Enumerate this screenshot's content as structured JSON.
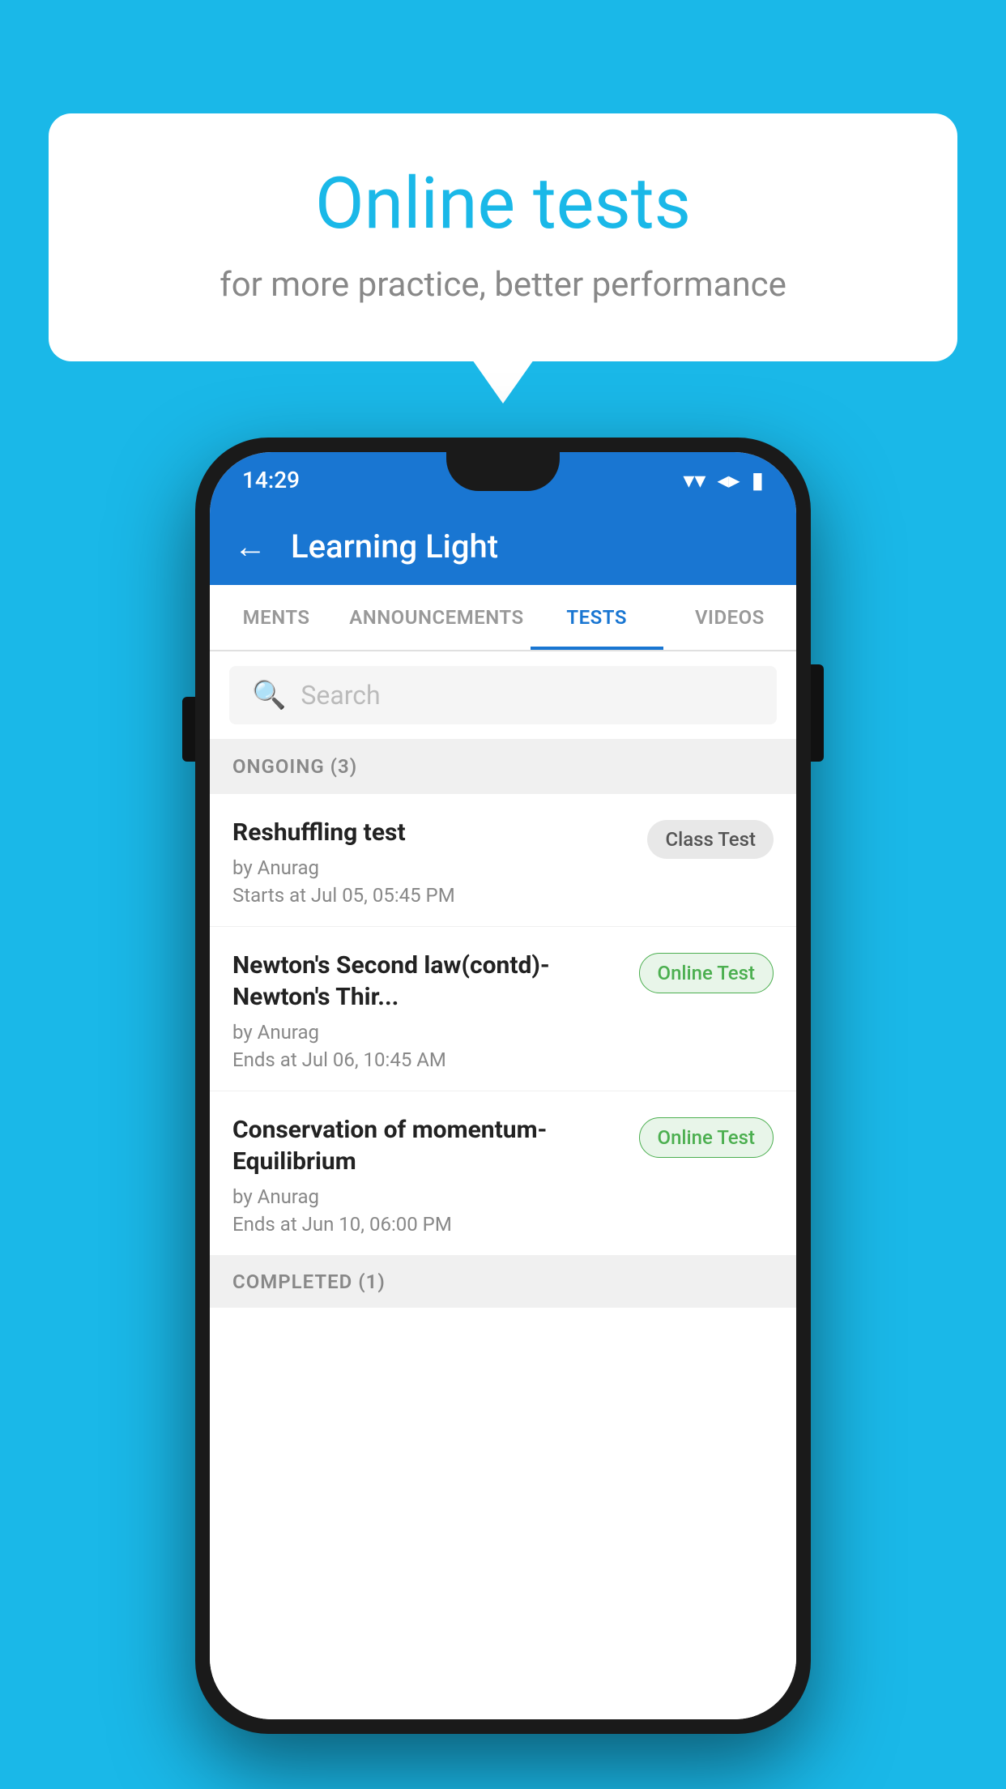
{
  "background_color": "#1ab8e8",
  "bubble": {
    "title": "Online tests",
    "subtitle": "for more practice, better performance"
  },
  "phone": {
    "status_bar": {
      "time": "14:29",
      "wifi": "▼",
      "signal": "▲",
      "battery": "▮"
    },
    "app_bar": {
      "title": "Learning Light",
      "back_label": "←"
    },
    "tabs": [
      {
        "label": "MENTS",
        "active": false
      },
      {
        "label": "ANNOUNCEMENTS",
        "active": false
      },
      {
        "label": "TESTS",
        "active": true
      },
      {
        "label": "VIDEOS",
        "active": false
      }
    ],
    "search": {
      "placeholder": "Search"
    },
    "section_ongoing": {
      "title": "ONGOING (3)"
    },
    "tests": [
      {
        "title": "Reshuffling test",
        "author": "by Anurag",
        "date": "Starts at  Jul 05, 05:45 PM",
        "badge": "Class Test",
        "badge_type": "class"
      },
      {
        "title": "Newton's Second law(contd)-Newton's Thir...",
        "author": "by Anurag",
        "date": "Ends at  Jul 06, 10:45 AM",
        "badge": "Online Test",
        "badge_type": "online"
      },
      {
        "title": "Conservation of momentum-Equilibrium",
        "author": "by Anurag",
        "date": "Ends at  Jun 10, 06:00 PM",
        "badge": "Online Test",
        "badge_type": "online"
      }
    ],
    "section_completed": {
      "title": "COMPLETED (1)"
    }
  }
}
